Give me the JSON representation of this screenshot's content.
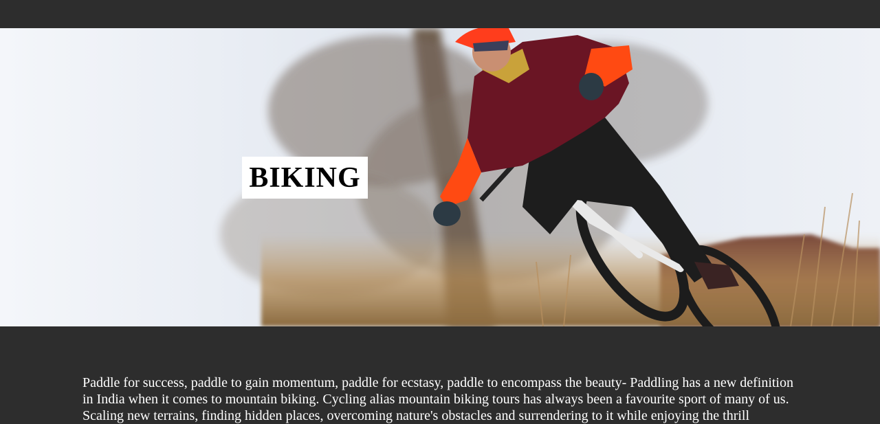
{
  "hero": {
    "title": "BIKING",
    "image": "mountain-biker-photo"
  },
  "content": {
    "intro": "Paddle for success, paddle to gain momentum, paddle for ecstasy, paddle to encompass the beauty- Paddling has a new definition in India when it comes to mountain biking. Cycling alias mountain biking tours has always been a favourite sport of many of us. Scaling new terrains, finding hidden places, overcoming nature's obstacles and surrendering to it while enjoying the thrill"
  },
  "colors": {
    "background": "#2d2d2d",
    "title_box": "#ffffff",
    "text": "#ffffff"
  }
}
